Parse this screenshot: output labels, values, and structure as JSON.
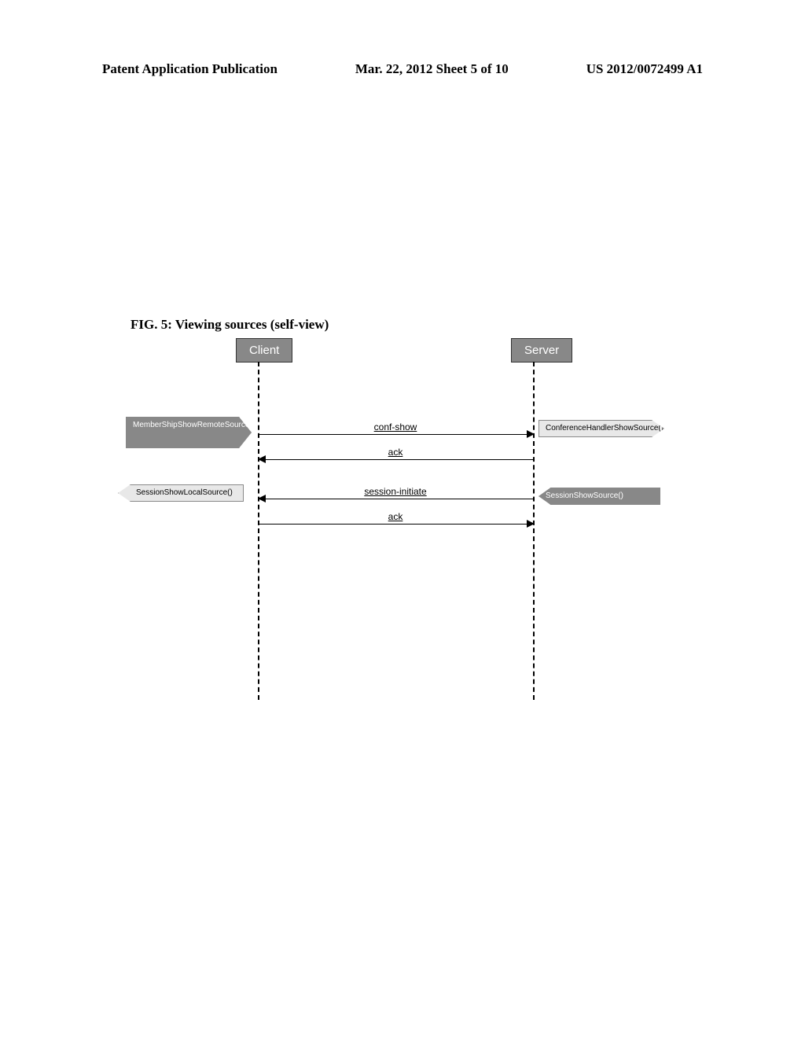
{
  "header": {
    "left": "Patent Application Publication",
    "center": "Mar. 22, 2012  Sheet 5 of 10",
    "right": "US 2012/0072499 A1"
  },
  "figure": {
    "caption": "FIG. 5: Viewing sources (self-view)"
  },
  "diagram": {
    "lifelines": {
      "client": "Client",
      "server": "Server"
    },
    "messages": [
      {
        "label": "conf-show",
        "direction": "right"
      },
      {
        "label": "ack",
        "direction": "left"
      },
      {
        "label": "session-initiate",
        "direction": "left"
      },
      {
        "label": "ack",
        "direction": "right"
      }
    ],
    "side_labels": {
      "top_left": "MemberShipShowRemoteSource('me','video')",
      "top_right": "ConferenceHandlerShowSource()",
      "bottom_left": "SessionShowLocalSource()",
      "bottom_right": "SessionShowSource()"
    }
  }
}
